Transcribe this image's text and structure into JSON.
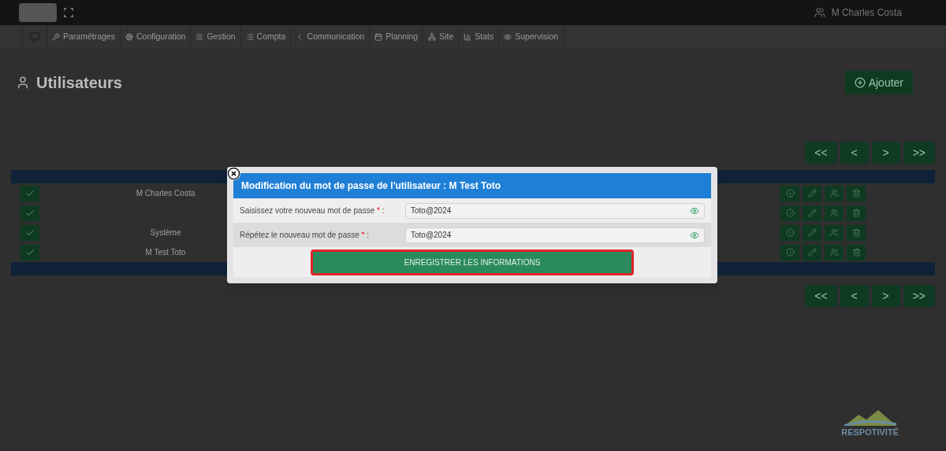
{
  "header": {
    "user": "M Charles Costa"
  },
  "menu": [
    {
      "label": "Paramétrages"
    },
    {
      "label": "Configuration"
    },
    {
      "label": "Gestion"
    },
    {
      "label": "Compta"
    },
    {
      "label": "Communication"
    },
    {
      "label": "Planning"
    },
    {
      "label": "Site"
    },
    {
      "label": "Stats"
    },
    {
      "label": "Supervision"
    }
  ],
  "page": {
    "title": "Utilisateurs",
    "add_button": "Ajouter"
  },
  "table": {
    "rows": [
      {
        "name": "M Charles Costa"
      },
      {},
      {
        "name": "Système"
      },
      {
        "name": "M Test Toto"
      }
    ]
  },
  "pagination": [
    "<<",
    "<",
    ">",
    ">>"
  ],
  "modal": {
    "title": "Modification du mot de passe de l'utilisateur : M Test Toto",
    "fields": [
      {
        "label": "Saisissez votre nouveau mot de passe",
        "mark": "*",
        "suffix": ":",
        "value": "Toto@2024"
      },
      {
        "label": "Répétez le nouveau mot de passe",
        "mark": "*",
        "suffix": ":",
        "value": "Toto@2024"
      }
    ],
    "submit": {
      "label": "ENREGISTRER LES INFORMATIONS",
      "highlighted": true
    }
  },
  "logo": {
    "text": "RESPOTIVITÉ"
  }
}
